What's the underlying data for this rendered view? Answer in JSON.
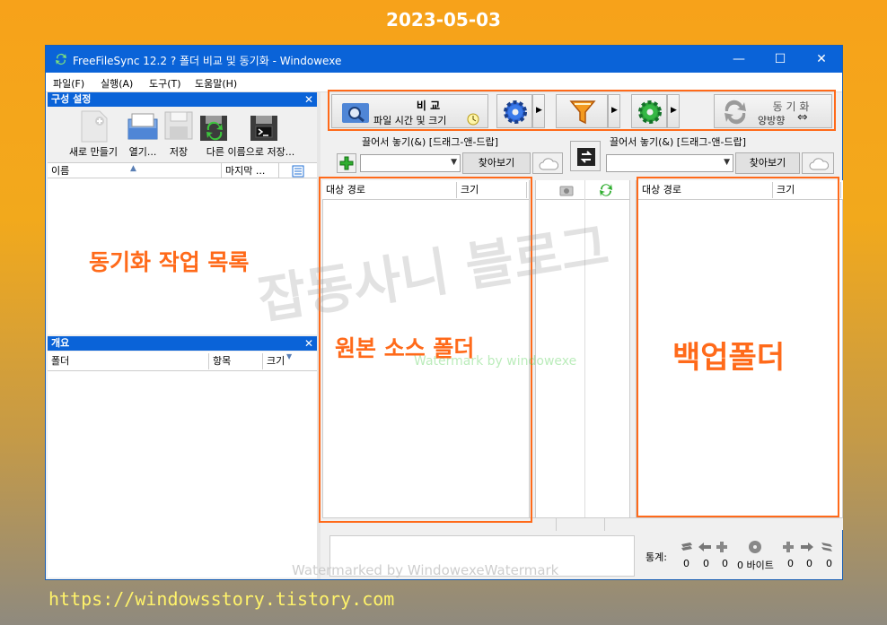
{
  "overlay": {
    "date": "2023-05-03",
    "url": "https://windowsstory.tistory.com",
    "watermark_big": "잡동사니 블로그",
    "watermark_green": "Watermark by windowexe",
    "watermark_bottom": "Watermarked by WindowexeWatermark"
  },
  "window": {
    "title": "FreeFileSync 12.2 ? 폴더 비교 및 동기화   - Windowexe",
    "controls": {
      "minimize": "—",
      "maximize": "☐",
      "close": "✕"
    }
  },
  "menu": [
    "파일(F)",
    "실행(A)",
    "도구(T)",
    "도움말(H)"
  ],
  "config_panel": {
    "title": "구성 설정",
    "close": "✕",
    "buttons": [
      "새로 만들기",
      "열기...",
      "저장",
      "다른 이름으로 저장..."
    ],
    "columns": [
      "이름",
      "마지막 ..."
    ]
  },
  "overview_panel": {
    "title": "개요",
    "close": "✕",
    "columns": [
      "폴더",
      "항목",
      "크기"
    ]
  },
  "toolbar": {
    "compare_label": "비  교",
    "compare_sub": "파일 시간 및 크기",
    "sync_label": "동  기  화",
    "sync_sub": "양방향"
  },
  "folder_bar": {
    "left_drop": "끌어서 놓기(&) [드래그-앤-드랍]",
    "right_drop": "끌어서 놓기(&) [드래그-앤-드랍]",
    "browse": "찾아보기"
  },
  "grid": {
    "left_columns": [
      "대상 경로",
      "크기"
    ],
    "right_columns": [
      "대상 경로",
      "크기"
    ]
  },
  "status": {
    "label": "통계:",
    "values": [
      "0",
      "0",
      "0",
      "0 바이트",
      "0",
      "0",
      "0"
    ]
  },
  "annotations": {
    "sync_list": "동기화 작업 목록",
    "source": "원본 소스 폴더",
    "backup": "백업폴더"
  },
  "colors": {
    "titlebar": "#0a63d8",
    "annotation": "#ff6a1a",
    "accent_blue": "#1f6fd6"
  }
}
